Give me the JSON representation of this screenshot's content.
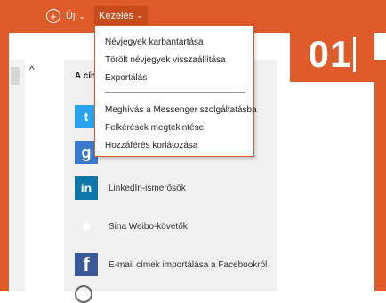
{
  "toolbar": {
    "new_label": "Új",
    "manage_label": "Kezelés"
  },
  "menu": {
    "items": [
      {
        "label": "Névjegyek karbantartása"
      },
      {
        "label": "Törölt névjegyek visszaállítása"
      },
      {
        "label": "Exportálás"
      },
      {
        "label": "Meghívás a Messenger szolgáltatásba"
      },
      {
        "label": "Felkérések megtekintése"
      },
      {
        "label": "Hozzáférés korlátozása"
      }
    ]
  },
  "content": {
    "title": "A cím",
    "sources": [
      {
        "label": "",
        "icon": "twitter-icon"
      },
      {
        "label": "",
        "icon": "google-icon"
      },
      {
        "label": "LinkedIn-ismerősök",
        "icon": "linkedin-icon"
      },
      {
        "label": "Sina Weibo-követők",
        "icon": "weibo-icon"
      },
      {
        "label": "E-mail címek importálása a Facebookról",
        "icon": "facebook-icon"
      }
    ]
  },
  "slide": {
    "number": "01"
  },
  "colors": {
    "accent": "#e05b2a",
    "accent_dark": "#c84b1c",
    "panel": "#f0f0f0"
  }
}
